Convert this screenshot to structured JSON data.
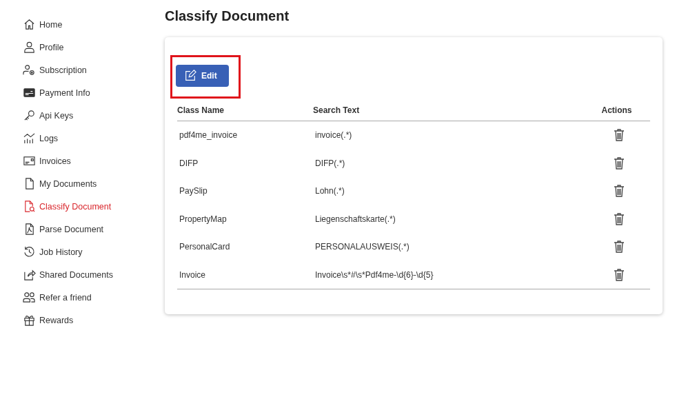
{
  "sidebar": {
    "items": [
      {
        "label": "Home",
        "selected": false
      },
      {
        "label": "Profile",
        "selected": false
      },
      {
        "label": "Subscription",
        "selected": false
      },
      {
        "label": "Payment Info",
        "selected": false
      },
      {
        "label": "Api Keys",
        "selected": false
      },
      {
        "label": "Logs",
        "selected": false
      },
      {
        "label": "Invoices",
        "selected": false
      },
      {
        "label": "My Documents",
        "selected": false
      },
      {
        "label": "Classify Document",
        "selected": true
      },
      {
        "label": "Parse Document",
        "selected": false
      },
      {
        "label": "Job History",
        "selected": false
      },
      {
        "label": "Shared Documents",
        "selected": false
      },
      {
        "label": "Refer a friend",
        "selected": false
      },
      {
        "label": "Rewards",
        "selected": false
      }
    ]
  },
  "page_title": "Classify Document",
  "edit_button": {
    "label": "Edit",
    "highlighted": true
  },
  "table": {
    "columns": [
      "Class Name",
      "Search Text",
      "Actions"
    ],
    "rows": [
      {
        "class_name": "pdf4me_invoice",
        "search_text": "invoice(.*)"
      },
      {
        "class_name": "DIFP",
        "search_text": "DIFP(.*)"
      },
      {
        "class_name": "PaySlip",
        "search_text": "Lohn(.*)"
      },
      {
        "class_name": "PropertyMap",
        "search_text": "Liegenschaftskarte(.*)"
      },
      {
        "class_name": "PersonalCard",
        "search_text": "PERSONALAUSWEIS(.*)"
      },
      {
        "class_name": "Invoice",
        "search_text": "Invoice\\s*#\\s*Pdf4me-\\d{6}-\\d{5}"
      }
    ]
  }
}
